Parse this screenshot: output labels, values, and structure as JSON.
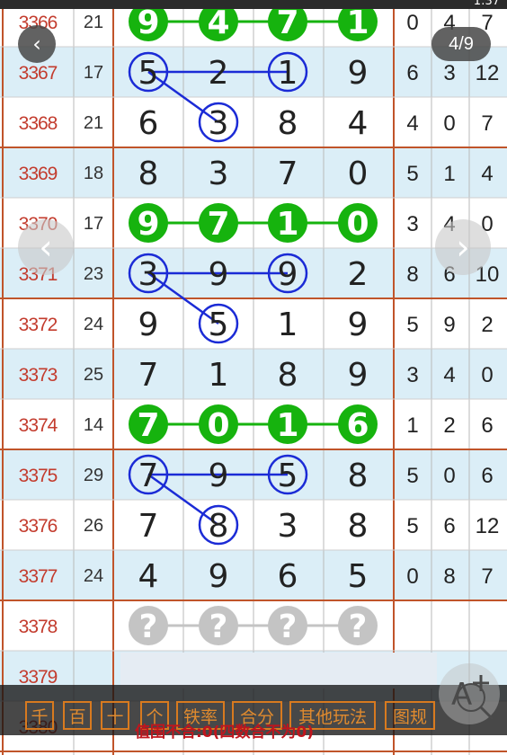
{
  "status_time": "1:37",
  "header": {
    "back_label": "‹",
    "page_indicator": "4/9"
  },
  "nav": {
    "prev_label": "‹",
    "next_label": "›"
  },
  "colors": {
    "row_alt": "#dbeef7",
    "row_base": "#ffffff",
    "issue_text": "#c33c2e",
    "divider": "#c0542a",
    "green": "#16b30e",
    "blue": "#1b2bd6",
    "pending": "#c4c4c4"
  },
  "rows": [
    {
      "issue": "3366",
      "sum": "21",
      "digits": [
        "9",
        "4",
        "7",
        "1"
      ],
      "stats": [
        "0",
        "4",
        "7"
      ],
      "mark": "green"
    },
    {
      "issue": "3367",
      "sum": "17",
      "digits": [
        "5",
        "2",
        "1",
        "9"
      ],
      "stats": [
        "6",
        "3",
        "12"
      ],
      "circled": [
        0,
        2
      ]
    },
    {
      "issue": "3368",
      "sum": "21",
      "digits": [
        "6",
        "3",
        "8",
        "4"
      ],
      "stats": [
        "4",
        "0",
        "7"
      ],
      "circled": [
        1
      ]
    },
    {
      "issue": "3369",
      "sum": "18",
      "digits": [
        "8",
        "3",
        "7",
        "0"
      ],
      "stats": [
        "5",
        "1",
        "4"
      ]
    },
    {
      "issue": "3370",
      "sum": "17",
      "digits": [
        "9",
        "7",
        "1",
        "0"
      ],
      "stats": [
        "3",
        "4",
        "0"
      ],
      "mark": "green"
    },
    {
      "issue": "3371",
      "sum": "23",
      "digits": [
        "3",
        "9",
        "9",
        "2"
      ],
      "stats": [
        "8",
        "6",
        "10"
      ],
      "circled": [
        0,
        2
      ]
    },
    {
      "issue": "3372",
      "sum": "24",
      "digits": [
        "9",
        "5",
        "1",
        "9"
      ],
      "stats": [
        "5",
        "9",
        "2"
      ],
      "circled": [
        1
      ]
    },
    {
      "issue": "3373",
      "sum": "25",
      "digits": [
        "7",
        "1",
        "8",
        "9"
      ],
      "stats": [
        "3",
        "4",
        "0"
      ]
    },
    {
      "issue": "3374",
      "sum": "14",
      "digits": [
        "7",
        "0",
        "1",
        "6"
      ],
      "stats": [
        "1",
        "2",
        "6"
      ],
      "mark": "green"
    },
    {
      "issue": "3375",
      "sum": "29",
      "digits": [
        "7",
        "9",
        "5",
        "8"
      ],
      "stats": [
        "5",
        "0",
        "6"
      ],
      "circled": [
        0,
        2
      ]
    },
    {
      "issue": "3376",
      "sum": "26",
      "digits": [
        "7",
        "8",
        "3",
        "8"
      ],
      "stats": [
        "5",
        "6",
        "12"
      ],
      "circled": [
        1
      ]
    },
    {
      "issue": "3377",
      "sum": "24",
      "digits": [
        "4",
        "9",
        "6",
        "5"
      ],
      "stats": [
        "0",
        "8",
        "7"
      ]
    },
    {
      "issue": "3378",
      "sum": "",
      "digits": [
        "?",
        "?",
        "?",
        "?"
      ],
      "stats": [
        "",
        "",
        ""
      ],
      "mark": "pending"
    },
    {
      "issue": "3379",
      "sum": "",
      "digits": [
        "",
        "",
        "",
        ""
      ],
      "stats": [
        "",
        "",
        ""
      ]
    },
    {
      "issue": "3380",
      "sum": "",
      "digits": [
        "",
        "",
        "",
        ""
      ],
      "stats": [
        "",
        "",
        ""
      ]
    }
  ],
  "toolbar": {
    "buttons": [
      "千",
      "百",
      "十",
      "个",
      "铁率",
      "合分",
      "其他玩法",
      "图规"
    ]
  },
  "summary_text": "值围不合:0(四数合不为0)"
}
